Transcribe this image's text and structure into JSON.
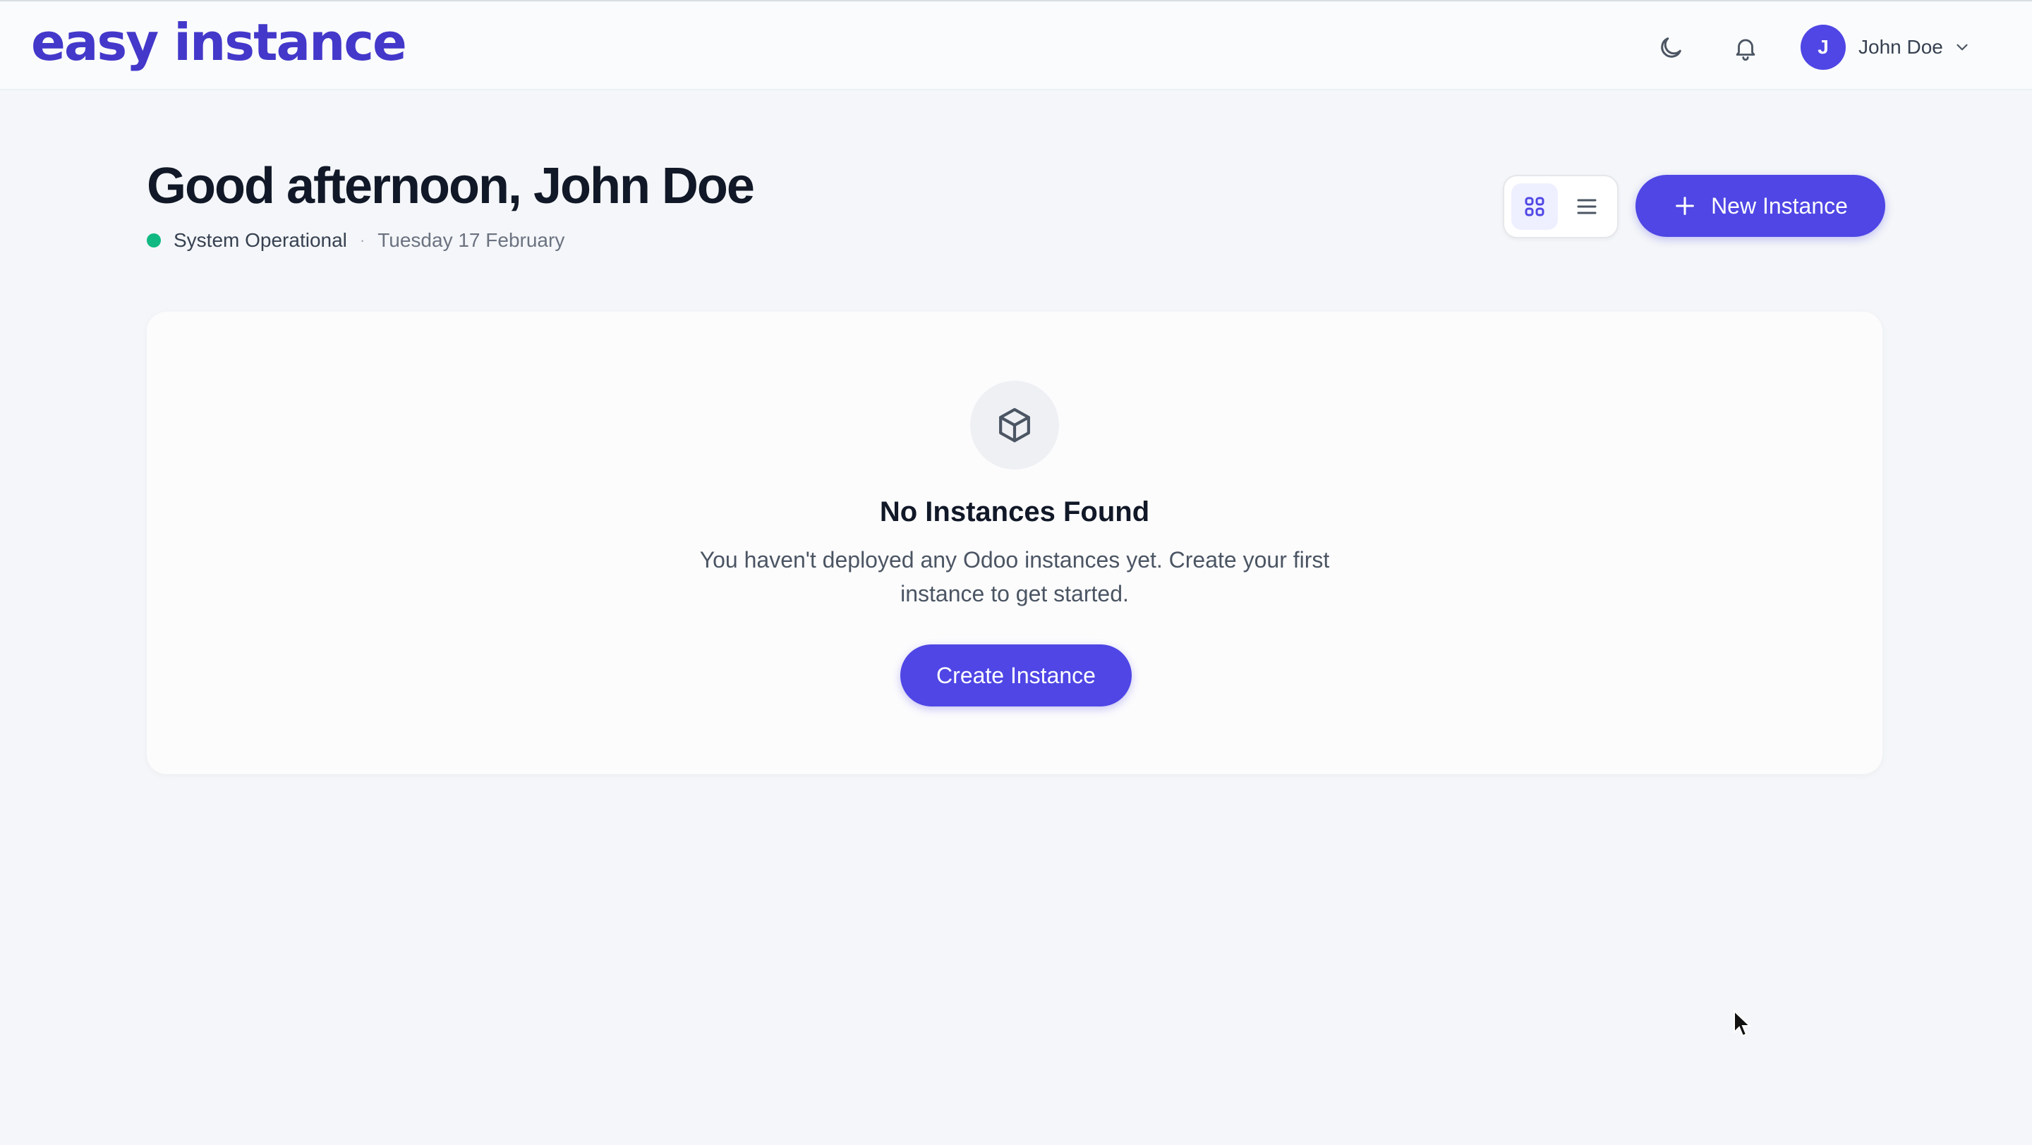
{
  "header": {
    "logo": "easy instance",
    "user": {
      "avatar_initial": "J",
      "name": "John Doe"
    },
    "icons": [
      "moon-icon",
      "bell-icon",
      "chevron-down-icon"
    ]
  },
  "main": {
    "greeting": "Good afternoon, John Doe",
    "status": {
      "text": "System Operational",
      "separator": "·",
      "date": "Tuesday 17 February",
      "color": "#10b981"
    },
    "new_instance_label": "New Instance"
  },
  "empty_state": {
    "title": "No Instances Found",
    "description": "You haven't deployed any Odoo instances yet. Create your first instance to get started.",
    "button_label": "Create Instance",
    "icon": "cube-icon"
  },
  "colors": {
    "accent": "#4f46e5",
    "logo": "#4338ca",
    "background": "#f4f6f9"
  }
}
